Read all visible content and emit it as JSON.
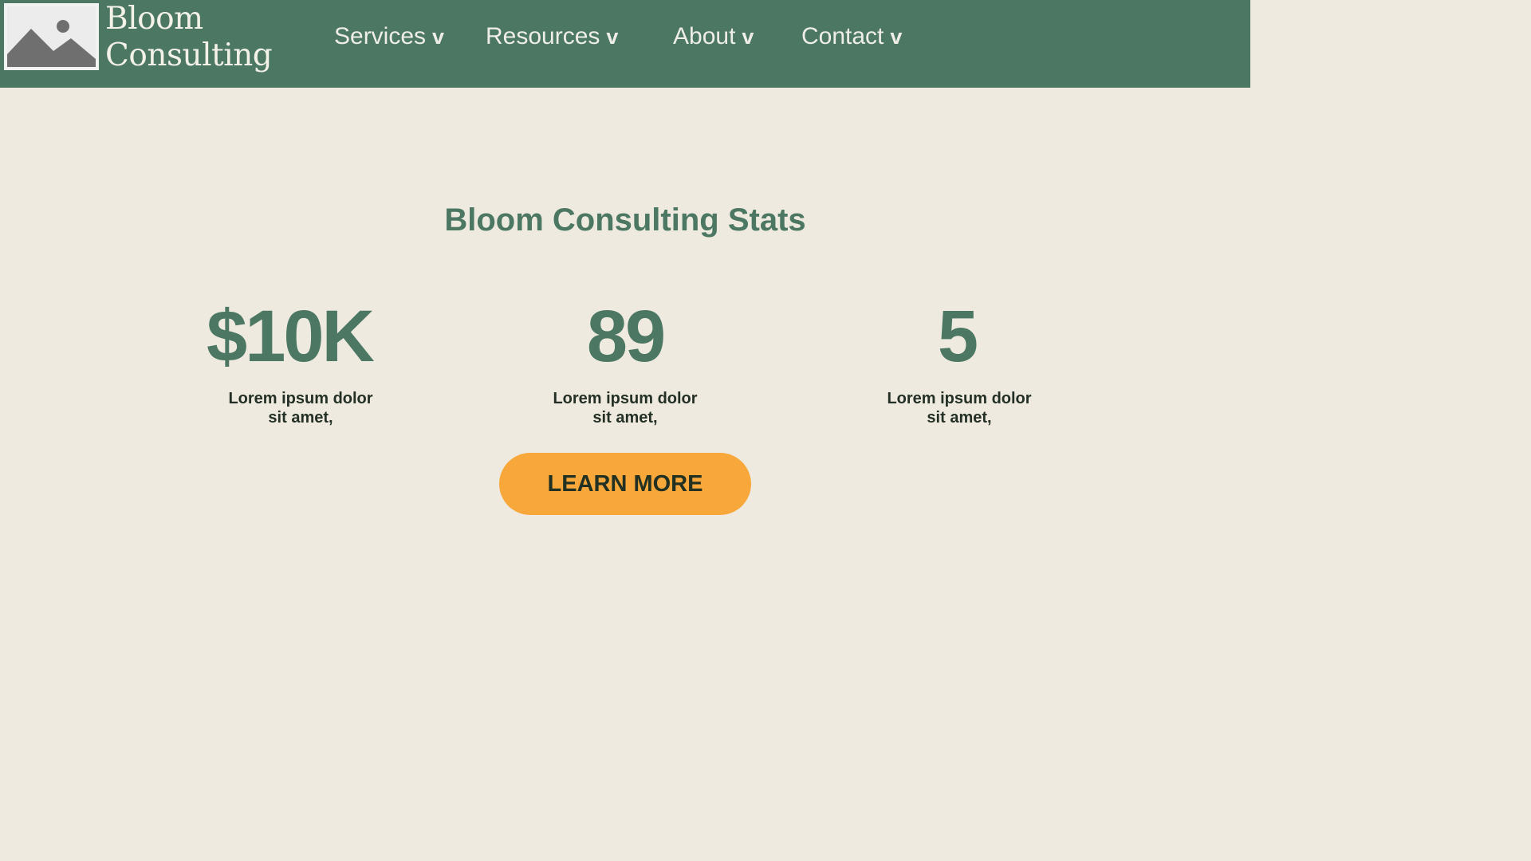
{
  "header": {
    "brand_line1": "Bloom",
    "brand_line2": "Consulting",
    "logo_icon": "image-placeholder-icon",
    "nav": [
      {
        "label": "Services",
        "chevron": "v"
      },
      {
        "label": "Resources",
        "chevron": "v"
      },
      {
        "label": "About",
        "chevron": "v"
      },
      {
        "label": "Contact",
        "chevron": "v"
      }
    ]
  },
  "stats": {
    "title": "Bloom Consulting Stats",
    "items": [
      {
        "value": "$10K",
        "desc_line1": "Lorem ipsum dolor",
        "desc_line2": "sit amet,"
      },
      {
        "value": "89",
        "desc_line1": "Lorem ipsum dolor",
        "desc_line2": "sit amet,"
      },
      {
        "value": "5",
        "desc_line1": "Lorem ipsum dolor",
        "desc_line2": "sit amet,"
      }
    ]
  },
  "cta": {
    "label": "LEARN MORE"
  },
  "colors": {
    "header_bg": "#4B7763",
    "page_bg": "#EEEADF",
    "accent": "#F8A83A",
    "dark_text": "#243026"
  }
}
